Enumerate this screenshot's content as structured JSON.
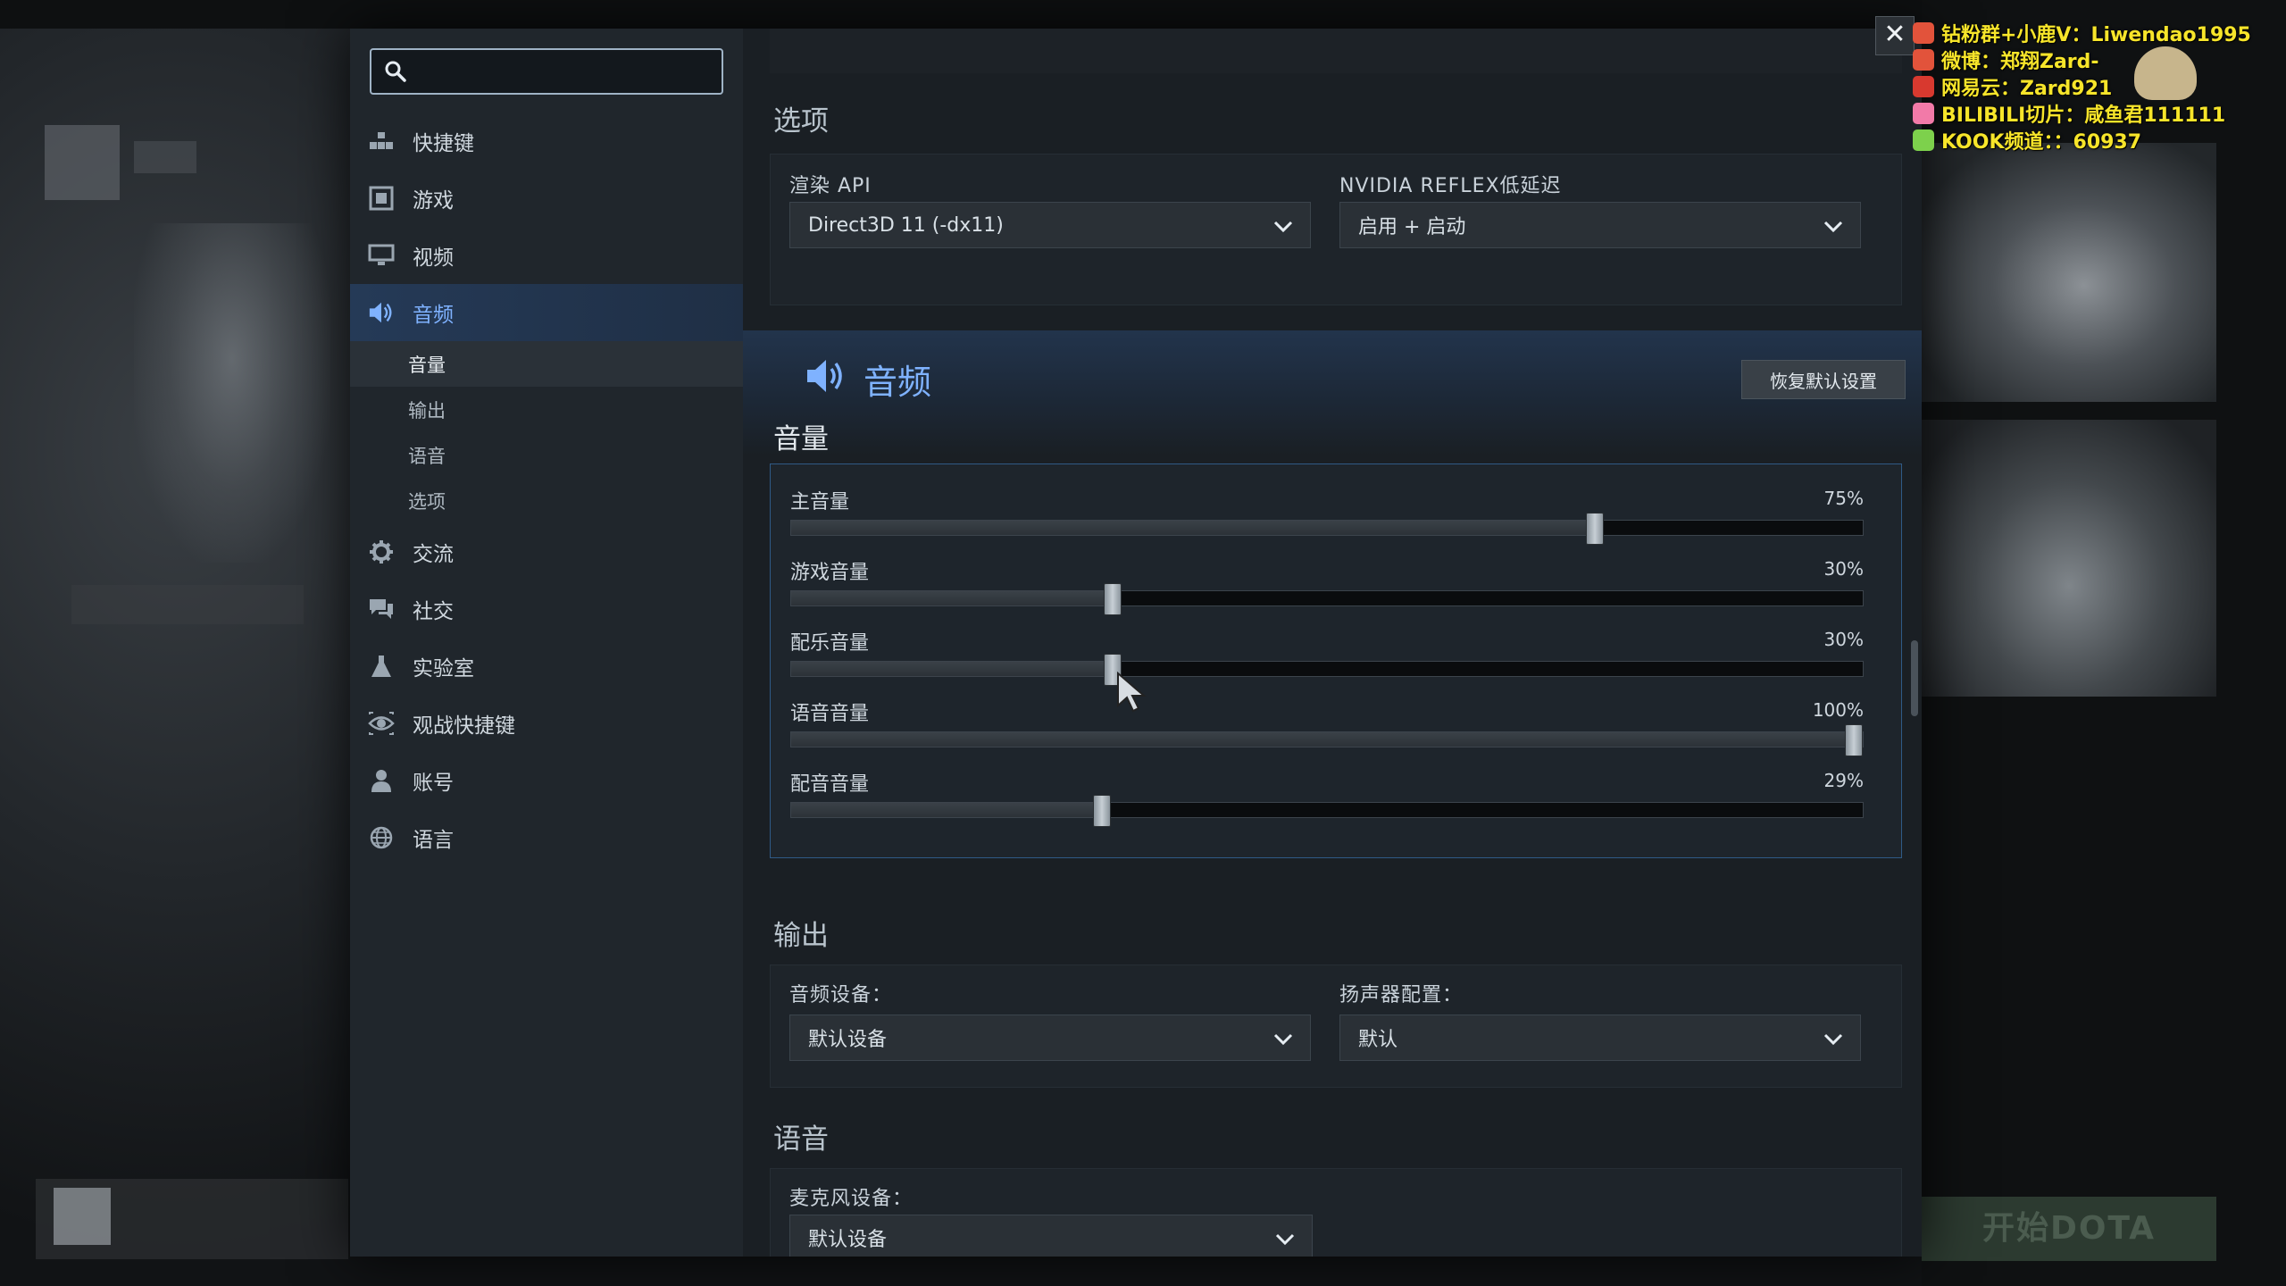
{
  "search": {
    "value": "",
    "placeholder": ""
  },
  "sidebar": {
    "items": [
      {
        "label": "快捷键",
        "icon": "hotkeys-icon"
      },
      {
        "label": "游戏",
        "icon": "game-icon"
      },
      {
        "label": "视频",
        "icon": "monitor-icon"
      },
      {
        "label": "音频",
        "icon": "speaker-icon",
        "active": true
      },
      {
        "label": "交流",
        "icon": "gear-icon"
      },
      {
        "label": "社交",
        "icon": "chat-icon"
      },
      {
        "label": "实验室",
        "icon": "flask-icon"
      },
      {
        "label": "观战快捷键",
        "icon": "eye-icon"
      },
      {
        "label": "账号",
        "icon": "user-icon"
      },
      {
        "label": "语言",
        "icon": "globe-icon"
      }
    ],
    "audio_subitems": [
      "音量",
      "输出",
      "语音",
      "选项"
    ]
  },
  "options": {
    "title": "选项",
    "render_api": {
      "label": "渲染 API",
      "value": "Direct3D 11 (-dx11)"
    },
    "nvidia_reflex": {
      "label": "NVIDIA REFLEX低延迟",
      "value": "启用 + 启动"
    }
  },
  "audio": {
    "title": "音频",
    "reset_label": "恢复默认设置",
    "volume": {
      "title": "音量",
      "sliders": [
        {
          "label": "主音量",
          "value": 75,
          "display": "75%"
        },
        {
          "label": "游戏音量",
          "value": 30,
          "display": "30%"
        },
        {
          "label": "配乐音量",
          "value": 30,
          "display": "30%"
        },
        {
          "label": "语音音量",
          "value": 100,
          "display": "100%"
        },
        {
          "label": "配音音量",
          "value": 29,
          "display": "29%"
        }
      ]
    },
    "output": {
      "title": "输出",
      "device": {
        "label": "音频设备：",
        "value": "默认设备"
      },
      "speaker": {
        "label": "扬声器配置：",
        "value": "默认"
      }
    },
    "voice": {
      "title": "语音",
      "mic": {
        "label": "麦克风设备：",
        "value": "默认设备"
      }
    }
  },
  "close_label": "✕",
  "overlay": [
    {
      "text": "钻粉群+小鹿V：Liwendao1995",
      "color": "#e2533b"
    },
    {
      "text": "微博：郑翔Zard-",
      "color": "#e2533b"
    },
    {
      "text": "网易云：Zard921",
      "color": "#d8392f"
    },
    {
      "text": "BILIBILI切片：咸鱼君111111",
      "color": "#f27aa8"
    },
    {
      "text": "KOOK频道：：60937",
      "color": "#7dd14c"
    }
  ],
  "background": {
    "play_button": "开始DOTA"
  },
  "colors": {
    "accent": "#7fb2ff",
    "overlay_text": "#f7e52a"
  }
}
